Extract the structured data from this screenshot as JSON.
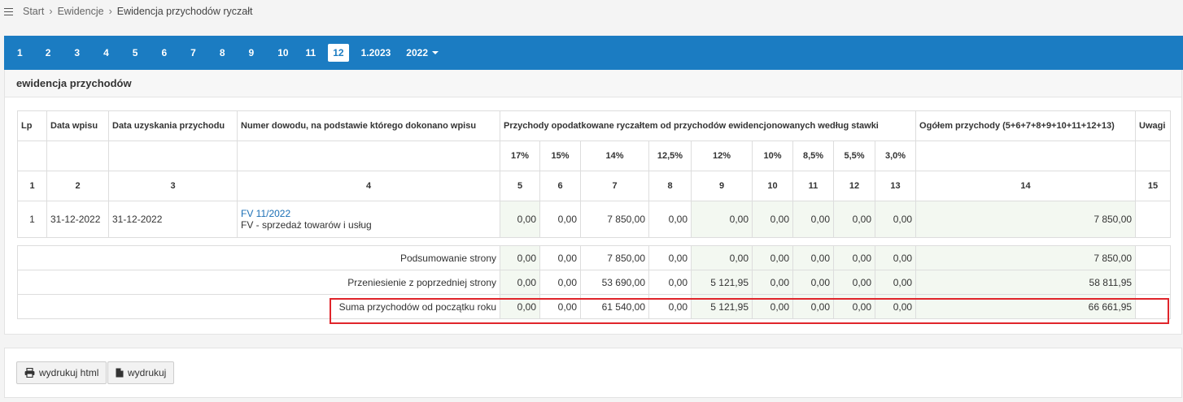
{
  "breadcrumb": {
    "items": [
      "Start",
      "Ewidencje",
      "Ewidencja przychodów ryczałt"
    ]
  },
  "tabs": [
    {
      "label": "1"
    },
    {
      "label": "2"
    },
    {
      "label": "3"
    },
    {
      "label": "4"
    },
    {
      "label": "5"
    },
    {
      "label": "6"
    },
    {
      "label": "7"
    },
    {
      "label": "8"
    },
    {
      "label": "9"
    },
    {
      "label": "10"
    },
    {
      "label": "11"
    },
    {
      "label": "12"
    },
    {
      "label": "1.2023"
    },
    {
      "label": "2022"
    }
  ],
  "active_tab": "12",
  "panel": {
    "title": "ewidencja przychodów"
  },
  "table": {
    "headers": {
      "lp": "Lp",
      "data_wpisu": "Data wpisu",
      "data_uzyskania": "Data uzyskania przychodu",
      "numer_dowodu": "Numer dowodu, na podstawie którego dokonano wpisu",
      "przychody": "Przychody opodatkowane ryczałtem od przychodów ewidencjonowanych według stawki",
      "ogolem": "Ogółem przychody (5+6+7+8+9+10+11+12+13)",
      "uwagi": "Uwagi"
    },
    "rates": [
      "17%",
      "15%",
      "14%",
      "12,5%",
      "12%",
      "10%",
      "8,5%",
      "5,5%",
      "3,0%"
    ],
    "col_numbers": [
      "1",
      "2",
      "3",
      "4",
      "5",
      "6",
      "7",
      "8",
      "9",
      "10",
      "11",
      "12",
      "13",
      "14",
      "15"
    ],
    "rows": [
      {
        "lp": "1",
        "data_wpisu": "31-12-2022",
        "data_uzyskania": "31-12-2022",
        "doc_link": "FV 11/2022",
        "doc_desc": "FV - sprzedaż towarów i usług",
        "values": [
          "0,00",
          "0,00",
          "7 850,00",
          "0,00",
          "0,00",
          "0,00",
          "0,00",
          "0,00",
          "0,00"
        ],
        "total": "7 850,00",
        "uwagi": ""
      }
    ],
    "summary": [
      {
        "label": "Podsumowanie strony",
        "values": [
          "0,00",
          "0,00",
          "7 850,00",
          "0,00",
          "0,00",
          "0,00",
          "0,00",
          "0,00",
          "0,00"
        ],
        "total": "7 850,00"
      },
      {
        "label": "Przeniesienie z poprzedniej strony",
        "values": [
          "0,00",
          "0,00",
          "53 690,00",
          "0,00",
          "5 121,95",
          "0,00",
          "0,00",
          "0,00",
          "0,00"
        ],
        "total": "58 811,95"
      },
      {
        "label": "Suma przychodów od początku roku",
        "values": [
          "0,00",
          "0,00",
          "61 540,00",
          "0,00",
          "5 121,95",
          "0,00",
          "0,00",
          "0,00",
          "0,00"
        ],
        "total": "66 661,95"
      }
    ]
  },
  "buttons": {
    "print_html": "wydrukuj html",
    "print": "wydrukuj"
  },
  "colors": {
    "tabbar": "#1b7cc2",
    "highlight": "#e0252b",
    "green_cell": "#f3f8f1"
  }
}
